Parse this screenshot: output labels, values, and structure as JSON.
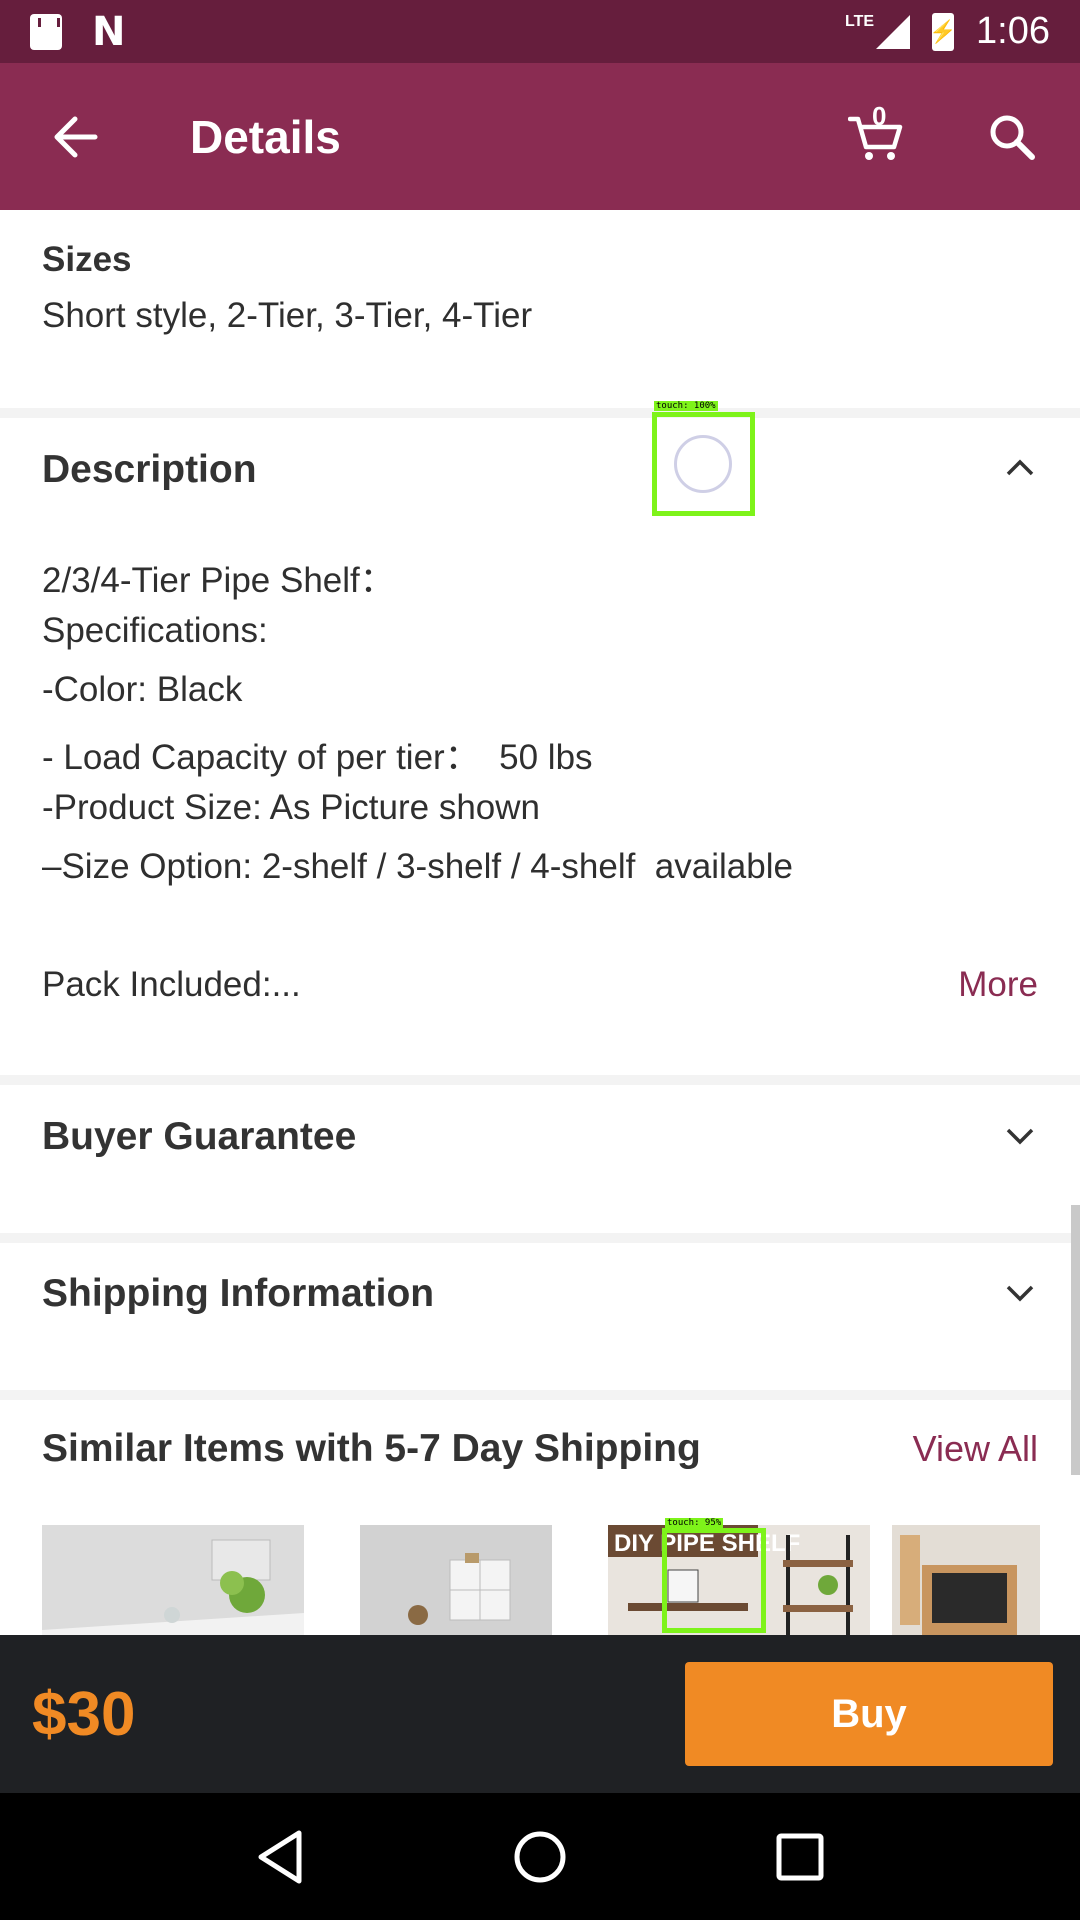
{
  "status_bar": {
    "time": "1:06",
    "network": "LTE"
  },
  "app_bar": {
    "title": "Details",
    "cart_count": "0"
  },
  "sizes": {
    "label": "Sizes",
    "value": "Short style, 2-Tier, 3-Tier, 4-Tier"
  },
  "description": {
    "title": "Description",
    "lines": [
      "2/3/4-Tier Pipe Shelf：",
      "Specifications:",
      "-Color: Black",
      "- Load Capacity of per tier：  50 lbs",
      "-Product Size: As Picture shown",
      "–Size Option: 2-shelf / 3-shelf / 4-shelf  available"
    ],
    "pack_line": "Pack Included:...",
    "more_label": "More"
  },
  "buyer_guarantee": {
    "title": "Buyer Guarantee"
  },
  "shipping_info": {
    "title": "Shipping Information"
  },
  "similar_items": {
    "title": "Similar Items with 5-7 Day Shipping",
    "view_all_label": "View All",
    "thumb_text": "DIY PIPE SHELF"
  },
  "overlays": {
    "touch_label_1": "touch: 100%",
    "touch_label_2": "touch: 95%"
  },
  "buy_bar": {
    "price": "$30",
    "buy_label": "Buy"
  },
  "colors": {
    "status_bar": "#661e3d",
    "app_bar": "#8a2c52",
    "accent": "#f08a24",
    "link": "#8a2c52"
  }
}
